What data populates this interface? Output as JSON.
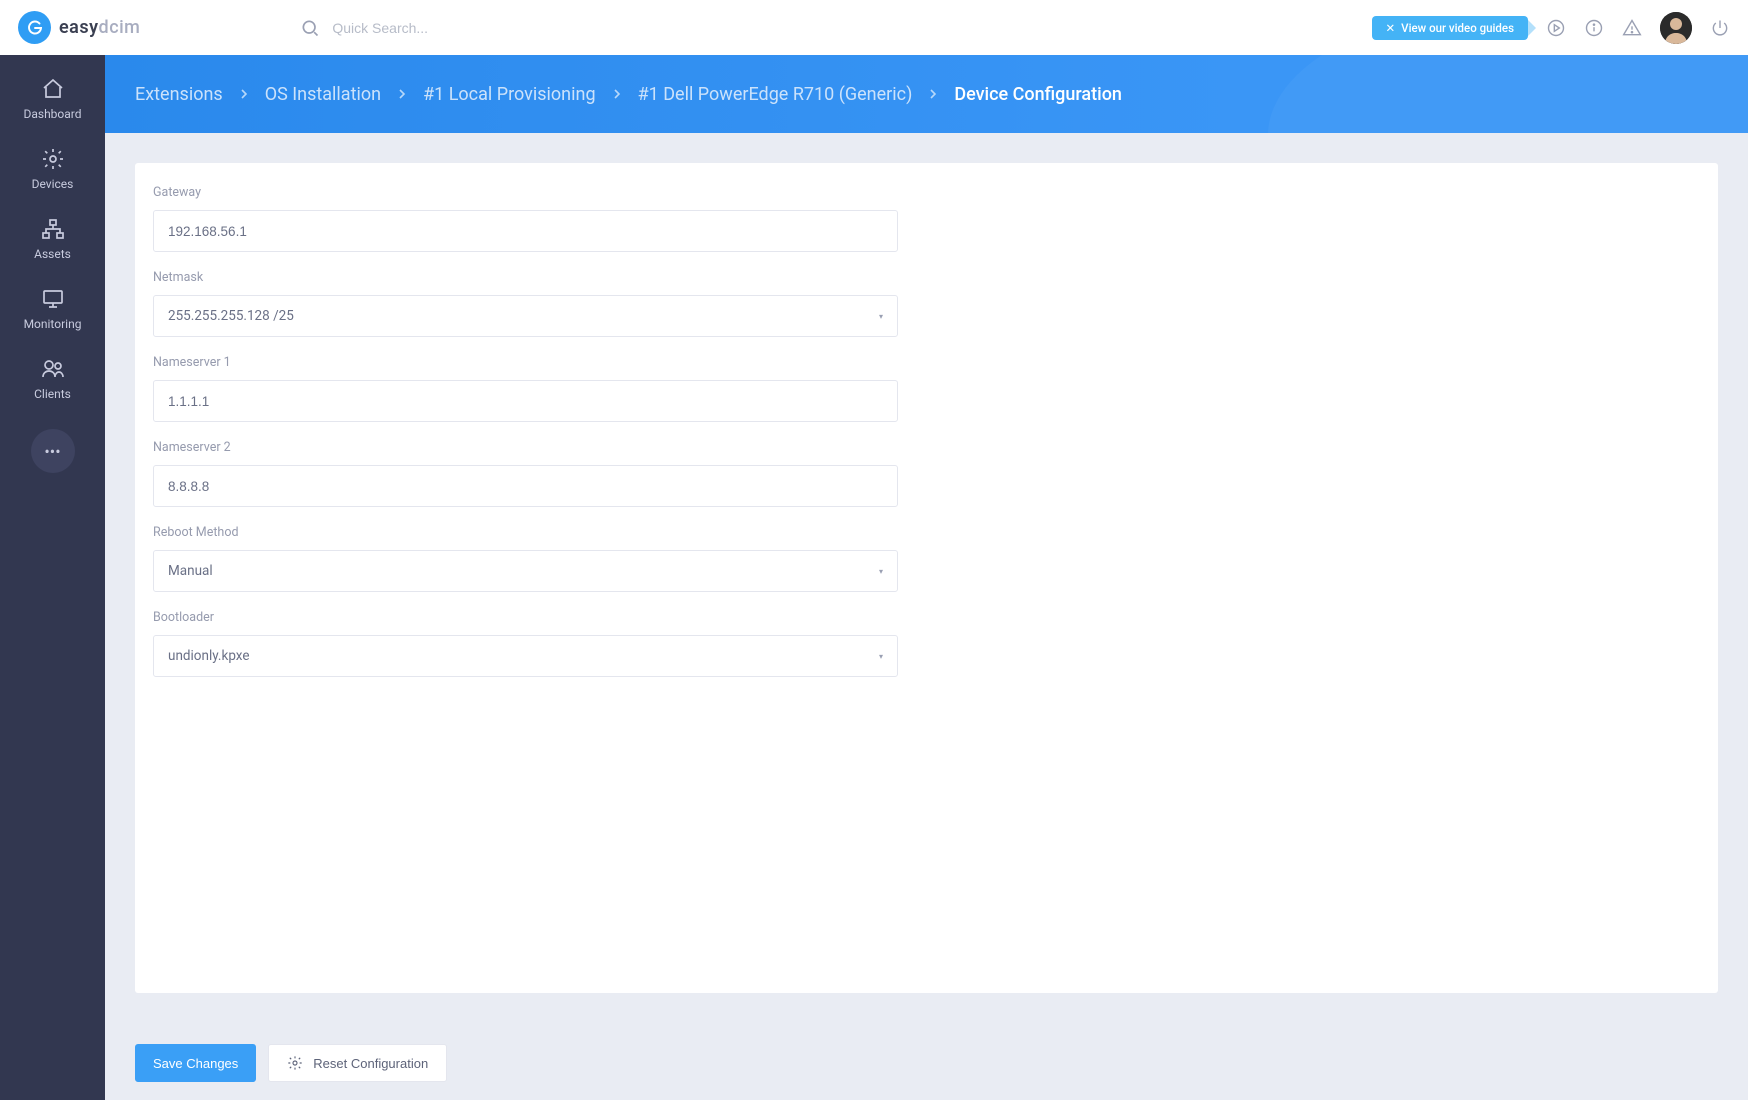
{
  "brand": {
    "name_prefix": "easy",
    "name_suffix": "dcim"
  },
  "search": {
    "placeholder": "Quick Search..."
  },
  "header": {
    "video_guides": "View our video guides"
  },
  "sidebar": {
    "items": [
      {
        "label": "Dashboard"
      },
      {
        "label": "Devices"
      },
      {
        "label": "Assets"
      },
      {
        "label": "Monitoring"
      },
      {
        "label": "Clients"
      }
    ]
  },
  "breadcrumb": {
    "items": [
      "Extensions",
      "OS Installation",
      "#1 Local Provisioning",
      "#1 Dell PowerEdge R710 (Generic)",
      "Device Configuration"
    ]
  },
  "form": {
    "gateway_label": "Gateway",
    "gateway_value": "192.168.56.1",
    "netmask_label": "Netmask",
    "netmask_value": "255.255.255.128 /25",
    "ns1_label": "Nameserver 1",
    "ns1_value": "1.1.1.1",
    "ns2_label": "Nameserver 2",
    "ns2_value": "8.8.8.8",
    "reboot_label": "Reboot Method",
    "reboot_value": "Manual",
    "bootloader_label": "Bootloader",
    "bootloader_value": "undionly.kpxe"
  },
  "actions": {
    "save": "Save Changes",
    "reset": "Reset Configuration"
  }
}
